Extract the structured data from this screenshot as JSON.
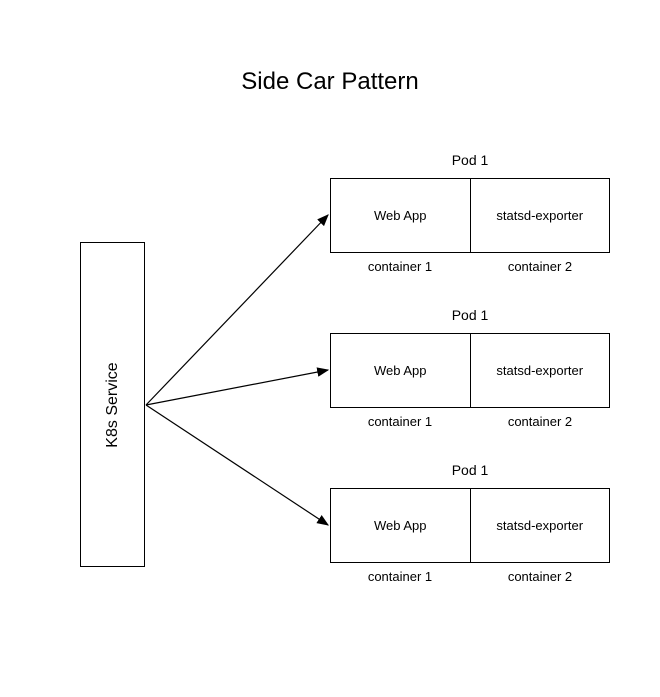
{
  "title": "Side Car Pattern",
  "service": {
    "label": "K8s Service"
  },
  "pods": [
    {
      "title": "Pod 1",
      "container1": {
        "name": "Web App",
        "label": "container 1"
      },
      "container2": {
        "name": "statsd-exporter",
        "label": "container 2"
      }
    },
    {
      "title": "Pod 1",
      "container1": {
        "name": "Web App",
        "label": "container 1"
      },
      "container2": {
        "name": "statsd-exporter",
        "label": "container 2"
      }
    },
    {
      "title": "Pod 1",
      "container1": {
        "name": "Web App",
        "label": "container 1"
      },
      "container2": {
        "name": "statsd-exporter",
        "label": "container 2"
      }
    }
  ]
}
